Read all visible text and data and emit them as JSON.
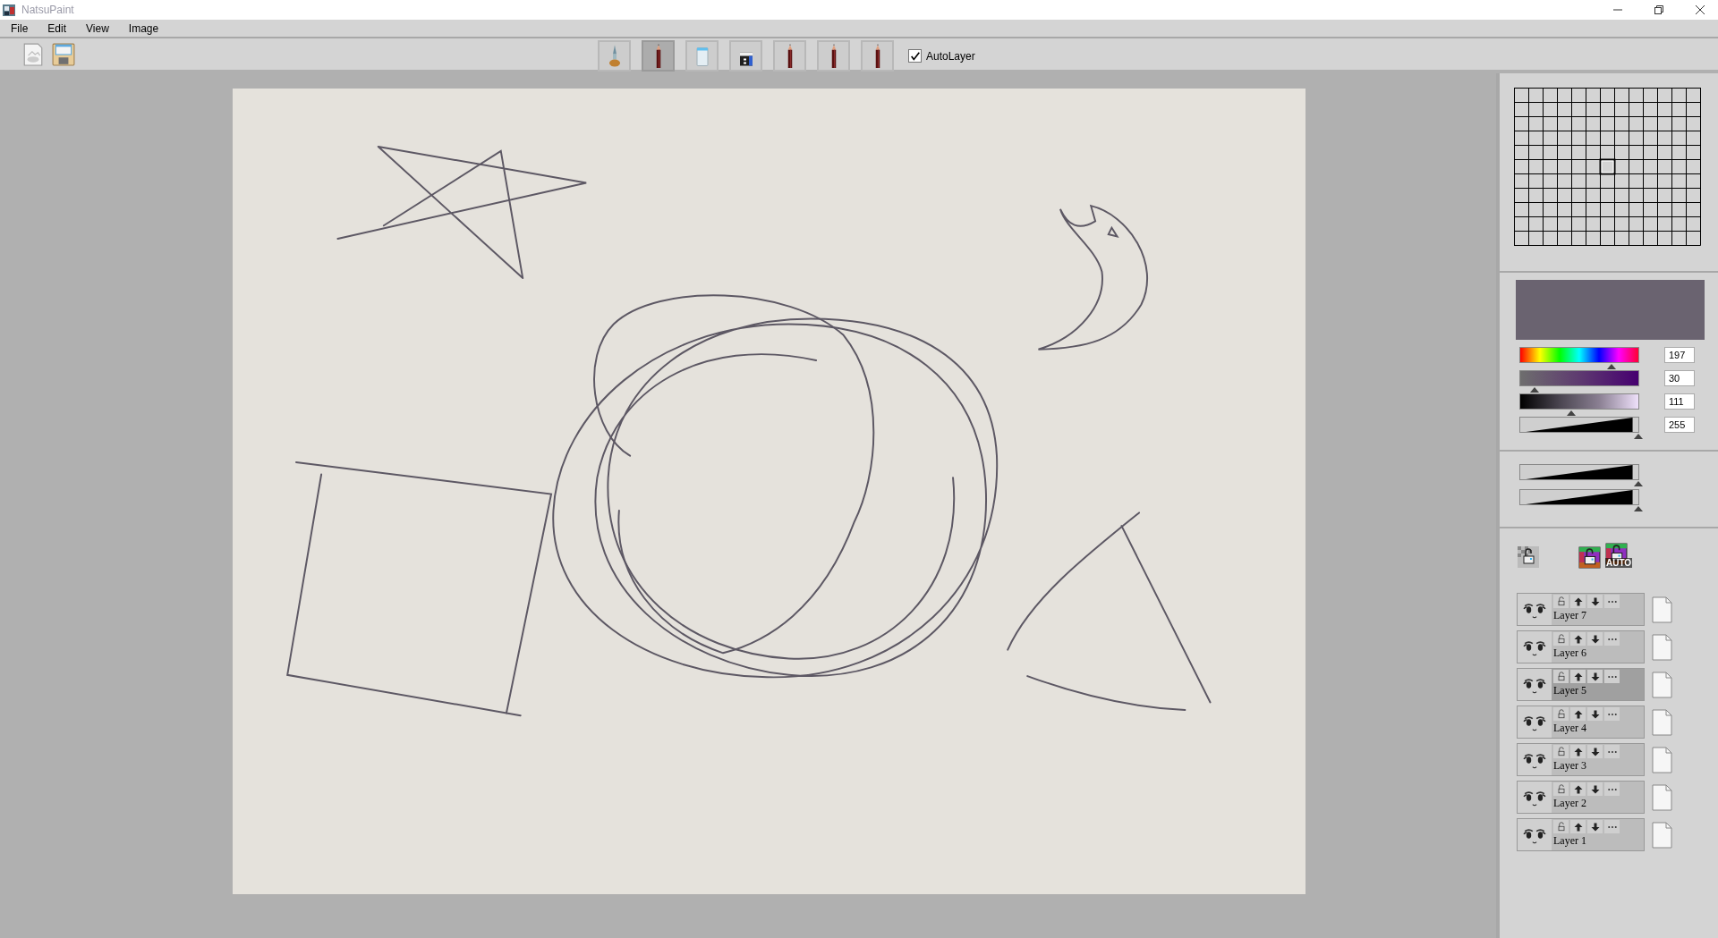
{
  "window": {
    "title": "NatsuPaint"
  },
  "menu": [
    "File",
    "Edit",
    "View",
    "Image"
  ],
  "file_toolbar": [
    {
      "kind": "new"
    },
    {
      "kind": "save"
    }
  ],
  "tools": [
    {
      "kind": "pen",
      "selected": false
    },
    {
      "kind": "pencil",
      "selected": true
    },
    {
      "kind": "glass",
      "selected": false
    },
    {
      "kind": "eraser",
      "selected": false
    },
    {
      "kind": "pencil",
      "selected": false
    },
    {
      "kind": "pencil",
      "selected": false
    },
    {
      "kind": "pencil",
      "selected": false
    }
  ],
  "auto_layer": {
    "label": "AutoLayer",
    "checked": true
  },
  "color_picker": {
    "swatch": {
      "color": "#6a6370"
    },
    "sliders": [
      {
        "kind": "hue",
        "level": 0.77,
        "value": "197"
      },
      {
        "kind": "saturation",
        "level": 0.12,
        "value": "30"
      },
      {
        "kind": "brightness",
        "level": 0.435,
        "value": "111"
      },
      {
        "kind": "alpha",
        "level": 1,
        "value": "255"
      }
    ]
  },
  "brush_sliders": [
    {
      "level": 1
    },
    {
      "level": 1
    }
  ],
  "lock_buttons": [
    {
      "kind": "transparency"
    },
    {
      "kind": "color"
    },
    {
      "kind": "auto",
      "label": "AUTO"
    }
  ],
  "layers": [
    {
      "name": "Layer 7",
      "selected": false
    },
    {
      "name": "Layer 6",
      "selected": false
    },
    {
      "name": "Layer 5",
      "selected": true
    },
    {
      "name": "Layer 4",
      "selected": false
    },
    {
      "name": "Layer 3",
      "selected": false
    },
    {
      "name": "Layer 2",
      "selected": false
    },
    {
      "name": "Layer 1",
      "selected": false
    }
  ]
}
